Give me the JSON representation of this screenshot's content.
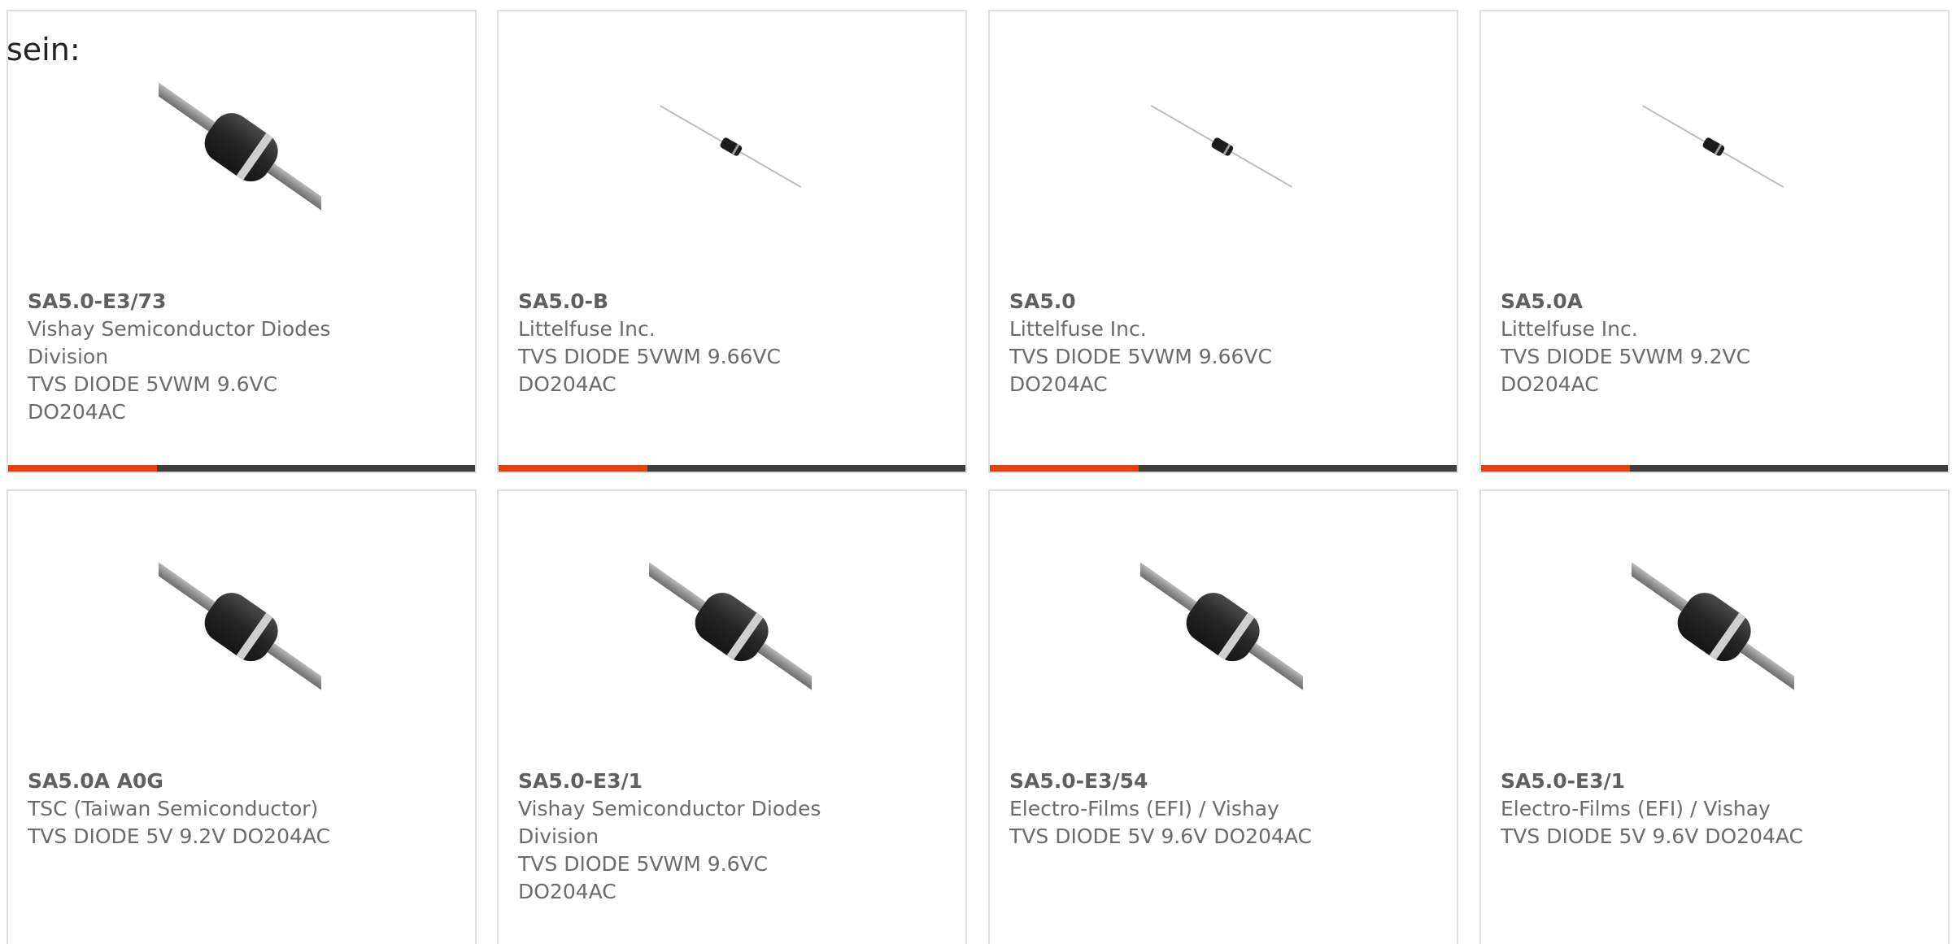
{
  "intro_text": "sein:",
  "colors": {
    "accent": "#e8400c",
    "bar": "#3e3e3e",
    "border": "#dedede",
    "text": "#6b6b6b"
  },
  "products": [
    {
      "part_number": "SA5.0-E3/73",
      "manufacturer": [
        "Vishay Semiconductor Diodes",
        "Division"
      ],
      "description": [
        "TVS DIODE 5VWM 9.6VC",
        "DO204AC"
      ],
      "image": "diode-large"
    },
    {
      "part_number": "SA5.0-B",
      "manufacturer": [
        "Littelfuse Inc."
      ],
      "description": [
        "TVS DIODE 5VWM 9.66VC",
        "DO204AC"
      ],
      "image": "diode-small"
    },
    {
      "part_number": "SA5.0",
      "manufacturer": [
        "Littelfuse Inc."
      ],
      "description": [
        "TVS DIODE 5VWM 9.66VC",
        "DO204AC"
      ],
      "image": "diode-small"
    },
    {
      "part_number": "SA5.0A",
      "manufacturer": [
        "Littelfuse Inc."
      ],
      "description": [
        "TVS DIODE 5VWM 9.2VC",
        "DO204AC"
      ],
      "image": "diode-small"
    },
    {
      "part_number": "SA5.0A A0G",
      "manufacturer": [
        "TSC (Taiwan Semiconductor)"
      ],
      "description": [
        "TVS DIODE 5V 9.2V DO204AC"
      ],
      "image": "diode-large"
    },
    {
      "part_number": "SA5.0-E3/1",
      "manufacturer": [
        "Vishay Semiconductor Diodes",
        "Division"
      ],
      "description": [
        "TVS DIODE 5VWM 9.6VC",
        "DO204AC"
      ],
      "image": "diode-large"
    },
    {
      "part_number": "SA5.0-E3/54",
      "manufacturer": [
        "Electro-Films (EFI) / Vishay"
      ],
      "description": [
        "TVS DIODE 5V 9.6V DO204AC"
      ],
      "image": "diode-large"
    },
    {
      "part_number": "SA5.0-E3/1",
      "manufacturer": [
        "Electro-Films (EFI) / Vishay"
      ],
      "description": [
        "TVS DIODE 5V 9.6V DO204AC"
      ],
      "image": "diode-large"
    }
  ]
}
